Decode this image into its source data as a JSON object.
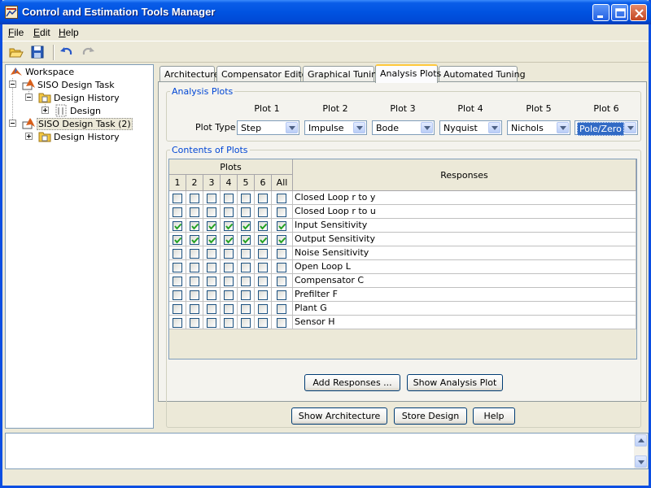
{
  "window": {
    "title": "Control and Estimation Tools Manager"
  },
  "menu": {
    "file": "File",
    "file_u": "F",
    "file_rest": "ile",
    "edit_u": "E",
    "edit_rest": "dit",
    "help_u": "H",
    "help_rest": "elp"
  },
  "toolbar": {
    "icons": [
      "open-folder-icon",
      "save-icon",
      "undo-icon",
      "redo-icon"
    ]
  },
  "tree": {
    "root": "Workspace",
    "task1": "SISO Design Task",
    "history1": "Design History",
    "design": "Design",
    "task2": "SISO Design Task (2)",
    "history2": "Design History"
  },
  "tabs": [
    "Architecture",
    "Compensator Editor",
    "Graphical Tuning",
    "Analysis Plots",
    "Automated Tuning"
  ],
  "active_tab": "Analysis Plots",
  "analysis_plots": {
    "group_title": "Analysis Plots",
    "plot_type_label": "Plot Type",
    "plots": [
      {
        "header": "Plot 1",
        "type": "Step"
      },
      {
        "header": "Plot 2",
        "type": "Impulse"
      },
      {
        "header": "Plot 3",
        "type": "Bode"
      },
      {
        "header": "Plot 4",
        "type": "Nyquist"
      },
      {
        "header": "Plot 5",
        "type": "Nichols"
      },
      {
        "header": "Plot 6",
        "type": "Pole/Zero"
      }
    ]
  },
  "contents": {
    "group_title": "Contents of Plots",
    "plots_header": "Plots",
    "columns": [
      "1",
      "2",
      "3",
      "4",
      "5",
      "6",
      "All"
    ],
    "responses_header": "Responses",
    "rows": [
      {
        "response": "Closed Loop r to y",
        "checked": [
          false,
          false,
          false,
          false,
          false,
          false,
          false
        ]
      },
      {
        "response": "Closed Loop r to u",
        "checked": [
          false,
          false,
          false,
          false,
          false,
          false,
          false
        ]
      },
      {
        "response": "Input Sensitivity",
        "checked": [
          true,
          true,
          true,
          true,
          true,
          true,
          true
        ]
      },
      {
        "response": "Output Sensitivity",
        "checked": [
          true,
          true,
          true,
          true,
          true,
          true,
          true
        ]
      },
      {
        "response": "Noise Sensitivity",
        "checked": [
          false,
          false,
          false,
          false,
          false,
          false,
          false
        ]
      },
      {
        "response": "Open Loop L",
        "checked": [
          false,
          false,
          false,
          false,
          false,
          false,
          false
        ]
      },
      {
        "response": "Compensator C",
        "checked": [
          false,
          false,
          false,
          false,
          false,
          false,
          false
        ]
      },
      {
        "response": "Prefilter F",
        "checked": [
          false,
          false,
          false,
          false,
          false,
          false,
          false
        ]
      },
      {
        "response": "Plant G",
        "checked": [
          false,
          false,
          false,
          false,
          false,
          false,
          false
        ]
      },
      {
        "response": "Sensor H",
        "checked": [
          false,
          false,
          false,
          false,
          false,
          false,
          false
        ]
      }
    ]
  },
  "buttons": {
    "add_responses": "Add Responses ...",
    "show_analysis_plot": "Show Analysis Plot",
    "show_architecture": "Show Architecture",
    "store_design": "Store Design",
    "help": "Help"
  },
  "colors": {
    "title_blue": "#0053e1",
    "group_title": "#0046d5",
    "check_green": "#21a121"
  }
}
